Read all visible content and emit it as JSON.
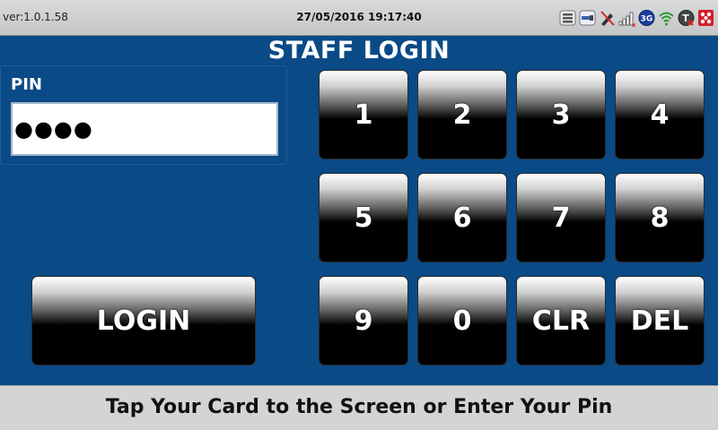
{
  "status_bar": {
    "version": "ver:1.0.1.58",
    "datetime": "27/05/2016 19:17:40",
    "network_badge": "3G",
    "icons": [
      "server-icon",
      "card-reader-icon",
      "pen-disabled-icon",
      "signal-bars-icon",
      "network-3g-icon",
      "wifi-icon",
      "terminal-icon",
      "app-logo-icon"
    ]
  },
  "title": "STAFF LOGIN",
  "pin": {
    "label": "PIN",
    "value": "●●●●"
  },
  "keypad": {
    "keys": [
      "1",
      "2",
      "3",
      "4",
      "5",
      "6",
      "7",
      "8",
      "9",
      "0",
      "CLR",
      "DEL"
    ]
  },
  "login_button": "LOGIN",
  "footer": "Tap Your Card to the Screen or Enter Your Pin",
  "colors": {
    "background": "#0a4a86",
    "status_bar": "#d0d2d4",
    "footer": "#d4d4d4"
  }
}
